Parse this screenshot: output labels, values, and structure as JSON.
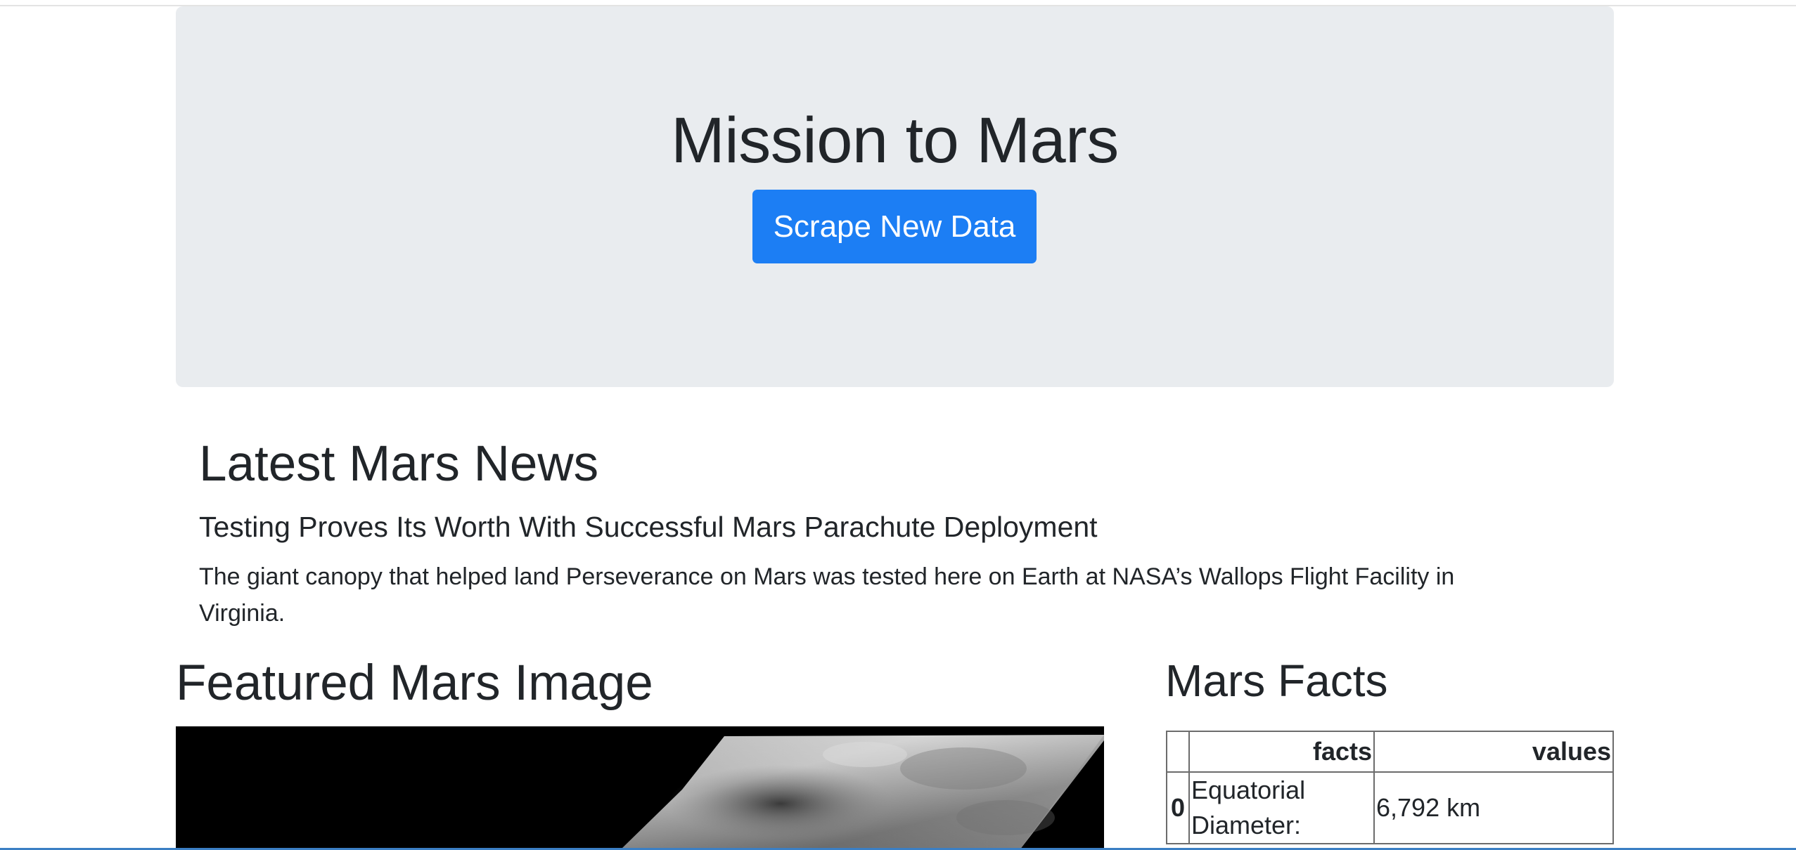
{
  "jumbotron": {
    "title": "Mission to Mars",
    "button_label": "Scrape New Data",
    "button_color": "#1c7ef4",
    "background": "#e9ecef"
  },
  "news": {
    "heading": "Latest Mars News",
    "title": "Testing Proves Its Worth With Successful Mars Parachute Deployment",
    "paragraph": "The giant canopy that helped land Perseverance on Mars was tested here on Earth at NASA’s Wallops Flight Facility in Virginia."
  },
  "featured": {
    "heading": "Featured Mars Image"
  },
  "facts": {
    "heading": "Mars Facts",
    "columns": [
      "",
      "facts",
      "values"
    ],
    "rows": [
      {
        "index": "0",
        "fact": "Equatorial Diameter:",
        "value": "6,792 km"
      }
    ]
  }
}
